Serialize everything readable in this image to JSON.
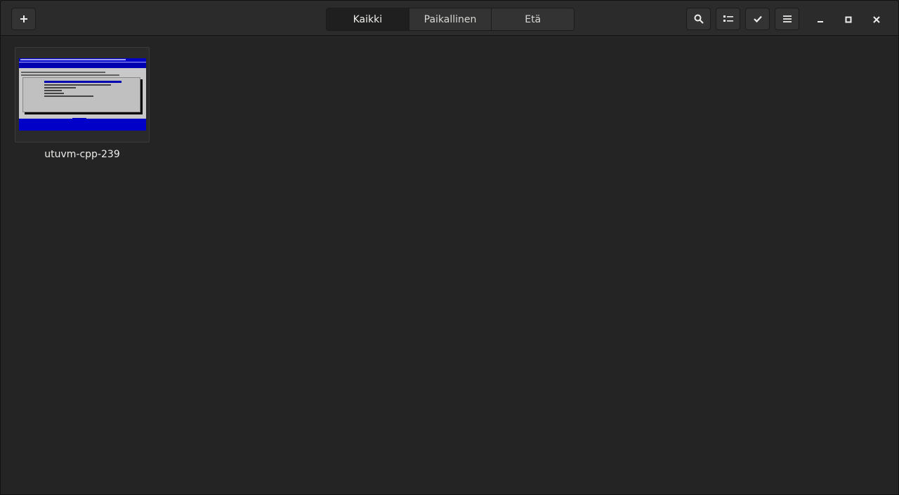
{
  "headerbar": {
    "new_button_icon": "plus-icon",
    "switcher": {
      "tabs": [
        {
          "label": "Kaikki",
          "active": true
        },
        {
          "label": "Paikallinen",
          "active": false
        },
        {
          "label": "Etä",
          "active": false
        }
      ]
    },
    "actions": [
      "search-icon",
      "view-list-icon",
      "select-check-icon",
      "menu-icon"
    ],
    "window_controls": [
      "minimize-icon",
      "maximize-icon",
      "close-icon"
    ]
  },
  "collection": {
    "items": [
      {
        "name": "utuvm-cpp-239",
        "thumbnail": "vm-screen-thumbnail"
      }
    ]
  },
  "colors": {
    "headerbar_bg": "#2b2b2b",
    "content_bg": "#242424",
    "thumbnail_blue": "#0000b0"
  }
}
